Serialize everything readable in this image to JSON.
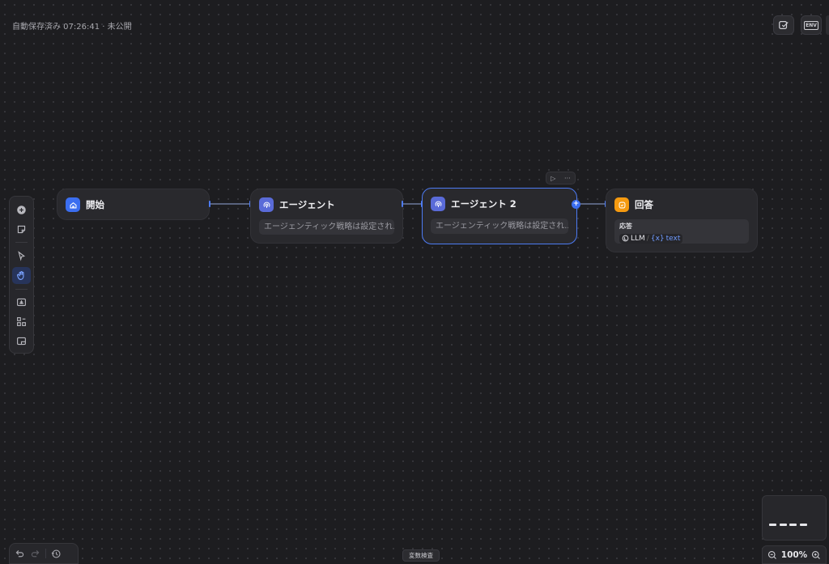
{
  "header": {
    "status": "自動保存済み 07:26:41 · 未公開",
    "env_label": "ENV"
  },
  "nodes": {
    "start": {
      "title": "開始",
      "color": "#3b6ef0"
    },
    "agent1": {
      "title": "エージェント",
      "desc": "エージェンティック戦略は設定され...",
      "color": "#5a6bd8"
    },
    "agent2": {
      "title": "エージェント 2",
      "desc": "エージェンティック戦略は設定され...",
      "color": "#5a6bd8"
    },
    "answer": {
      "title": "回答",
      "color": "#f59a10",
      "field_label": "応答",
      "source": "LLM",
      "separator": "/",
      "variable_prefix": "{x}",
      "variable": "text"
    }
  },
  "node_actions": {
    "run": "▷",
    "more": "···"
  },
  "bottom": {
    "variable_check": "変数検査",
    "zoom": "100%"
  },
  "colors": {
    "accent": "#4d7bf3",
    "canvas": "#1d1d20"
  }
}
